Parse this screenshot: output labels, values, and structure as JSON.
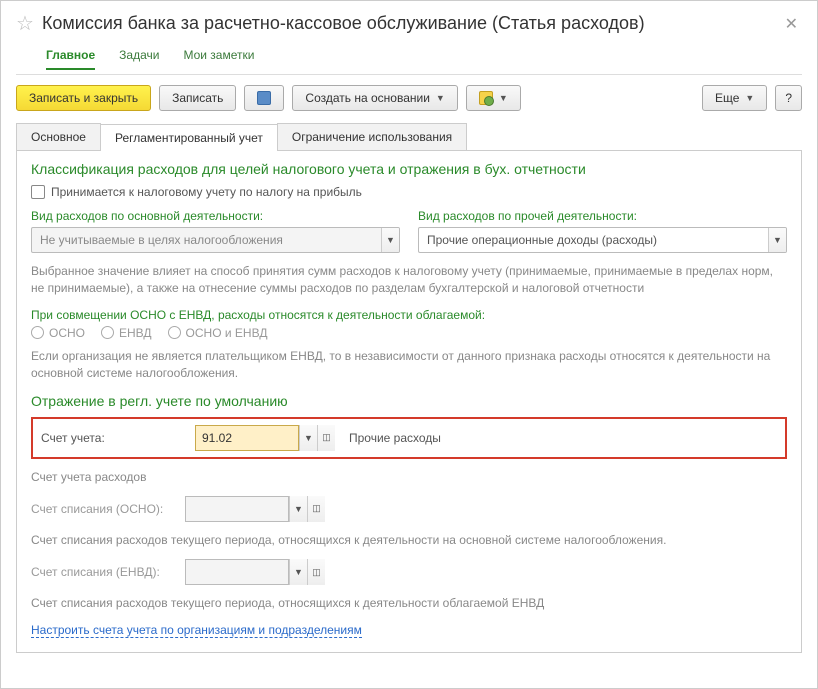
{
  "header": {
    "title": "Комиссия банка за расчетно-кассовое обслуживание (Статья расходов)"
  },
  "nav": {
    "main": "Главное",
    "tasks": "Задачи",
    "notes": "Мои заметки"
  },
  "toolbar": {
    "save_close": "Записать и закрыть",
    "save": "Записать",
    "create_based": "Создать на основании",
    "more": "Еще",
    "help": "?"
  },
  "subtabs": {
    "basic": "Основное",
    "regulated": "Регламентированный учет",
    "restriction": "Ограничение использования"
  },
  "sections": {
    "classification_title": "Классификация расходов для целей налогового учета и отражения в бух. отчетности",
    "tax_checkbox": "Принимается к налоговому учету по налогу на прибыль",
    "main_activity_label": "Вид расходов по основной деятельности:",
    "main_activity_value": "Не учитываемые в целях налогообложения",
    "other_activity_label": "Вид расходов по прочей деятельности:",
    "other_activity_value": "Прочие операционные доходы (расходы)",
    "help1": "Выбранное значение влияет на способ принятия сумм расходов к налоговому учету (принимаемые, принимаемые в пределах норм, не принимаемые), а также на отнесение суммы расходов по разделам бухгалтерской и налоговой отчетности",
    "combined_title": "При совмещении ОСНО с ЕНВД, расходы относятся к деятельности облагаемой:",
    "radio_osno": "ОСНО",
    "radio_envd": "ЕНВД",
    "radio_both": "ОСНО и ЕНВД",
    "help2": "Если организация не является плательщиком ЕНВД, то в независимости от данного признака расходы относятся к деятельности на основной системе налогообложения.",
    "default_title": "Отражение в регл. учете по умолчанию",
    "account_label": "Счет учета:",
    "account_value": "91.02",
    "account_desc": "Прочие расходы",
    "expense_account_help": "Счет учета расходов",
    "writeoff_osno_label": "Счет списания (ОСНО):",
    "writeoff_osno_help": "Счет списания расходов текущего периода, относящихся к деятельности на основной системе налогообложения.",
    "writeoff_envd_label": "Счет списания (ЕНВД):",
    "writeoff_envd_help": "Счет списания расходов текущего периода, относящихся к деятельности облагаемой ЕНВД",
    "configure_link": "Настроить счета учета по организациям и подразделениям"
  }
}
